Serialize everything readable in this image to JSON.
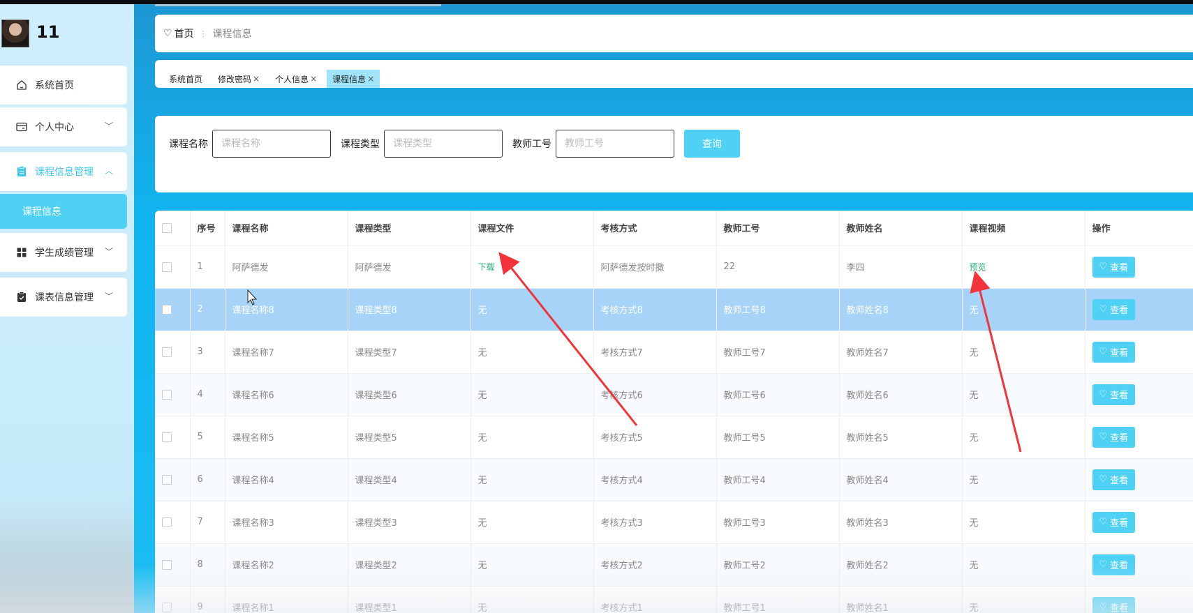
{
  "user": {
    "name": "11"
  },
  "sidebar": {
    "items": [
      {
        "label": "系统首页",
        "icon": "home-icon",
        "active": false
      },
      {
        "label": "个人中心",
        "icon": "card-icon",
        "active": false
      },
      {
        "label": "课程信息管理",
        "icon": "clipboard-icon",
        "active": true
      },
      {
        "label": "学生成绩管理",
        "icon": "grid-icon",
        "active": false
      },
      {
        "label": "课表信息管理",
        "icon": "checklist-icon",
        "active": false
      }
    ],
    "submenu": "课程信息"
  },
  "breadcrumb": {
    "home": "首页",
    "current": "课程信息"
  },
  "tabs": [
    {
      "label": "系统首页",
      "closable": false,
      "active": false
    },
    {
      "label": "修改密码",
      "closable": true,
      "active": false
    },
    {
      "label": "个人信息",
      "closable": true,
      "active": false
    },
    {
      "label": "课程信息",
      "closable": true,
      "active": true
    }
  ],
  "search": {
    "course_name_label": "课程名称",
    "course_name_placeholder": "课程名称",
    "course_type_label": "课程类型",
    "course_type_placeholder": "课程类型",
    "teacher_id_label": "教师工号",
    "teacher_id_placeholder": "教师工号",
    "query_button": "查询"
  },
  "table": {
    "headers": [
      "序号",
      "课程名称",
      "课程类型",
      "课程文件",
      "考核方式",
      "教师工号",
      "教师姓名",
      "课程视频",
      "操作"
    ],
    "view_label": "查看",
    "rows": [
      {
        "index": "1",
        "name": "阿萨德发",
        "type": "阿萨德发",
        "file": "下载",
        "file_link": true,
        "exam": "阿萨德发按时撒",
        "teacher_id": "22",
        "teacher_name": "李四",
        "video": "预览",
        "video_link": true,
        "selected": false
      },
      {
        "index": "2",
        "name": "课程名称8",
        "type": "课程类型8",
        "file": "无",
        "file_link": false,
        "exam": "考核方式8",
        "teacher_id": "教师工号8",
        "teacher_name": "教师姓名8",
        "video": "无",
        "video_link": false,
        "selected": true
      },
      {
        "index": "3",
        "name": "课程名称7",
        "type": "课程类型7",
        "file": "无",
        "file_link": false,
        "exam": "考核方式7",
        "teacher_id": "教师工号7",
        "teacher_name": "教师姓名7",
        "video": "无",
        "video_link": false,
        "selected": false
      },
      {
        "index": "4",
        "name": "课程名称6",
        "type": "课程类型6",
        "file": "无",
        "file_link": false,
        "exam": "考核方式6",
        "teacher_id": "教师工号6",
        "teacher_name": "教师姓名6",
        "video": "无",
        "video_link": false,
        "selected": false
      },
      {
        "index": "5",
        "name": "课程名称5",
        "type": "课程类型5",
        "file": "无",
        "file_link": false,
        "exam": "考核方式5",
        "teacher_id": "教师工号5",
        "teacher_name": "教师姓名5",
        "video": "无",
        "video_link": false,
        "selected": false
      },
      {
        "index": "6",
        "name": "课程名称4",
        "type": "课程类型4",
        "file": "无",
        "file_link": false,
        "exam": "考核方式4",
        "teacher_id": "教师工号4",
        "teacher_name": "教师姓名4",
        "video": "无",
        "video_link": false,
        "selected": false
      },
      {
        "index": "7",
        "name": "课程名称3",
        "type": "课程类型3",
        "file": "无",
        "file_link": false,
        "exam": "考核方式3",
        "teacher_id": "教师工号3",
        "teacher_name": "教师姓名3",
        "video": "无",
        "video_link": false,
        "selected": false
      },
      {
        "index": "8",
        "name": "课程名称2",
        "type": "课程类型2",
        "file": "无",
        "file_link": false,
        "exam": "考核方式2",
        "teacher_id": "教师工号2",
        "teacher_name": "教师姓名2",
        "video": "无",
        "video_link": false,
        "selected": false
      },
      {
        "index": "9",
        "name": "课程名称1",
        "type": "课程类型1",
        "file": "无",
        "file_link": false,
        "exam": "考核方式1",
        "teacher_id": "教师工号1",
        "teacher_name": "教师姓名1",
        "video": "无",
        "video_link": false,
        "selected": false
      }
    ]
  },
  "colors": {
    "accent": "#4fd1f6",
    "link": "#2aaf75",
    "selected_row": "#a6d3f7",
    "annotation_arrow": "#f2343a"
  }
}
